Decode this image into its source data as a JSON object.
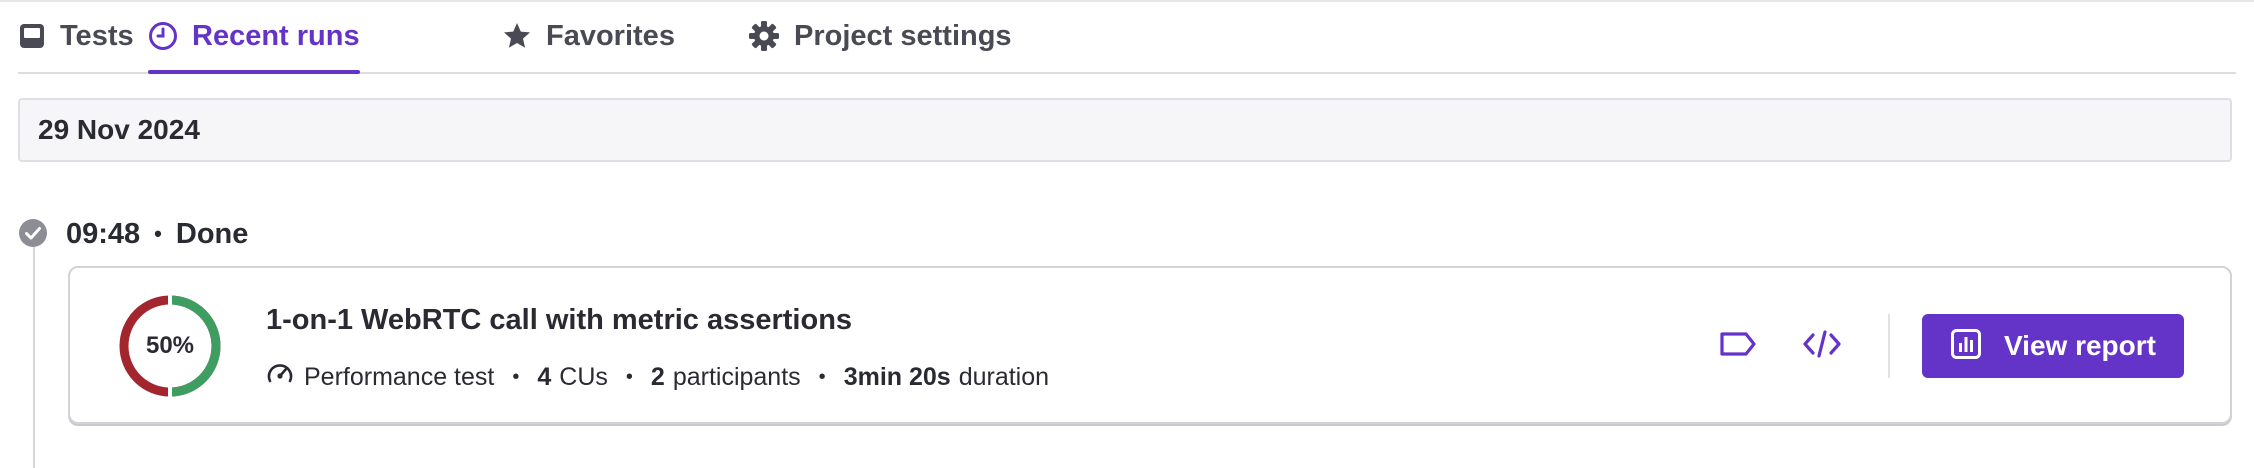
{
  "tabs": [
    {
      "label": "Tests",
      "icon": "inbox-icon",
      "active": false
    },
    {
      "label": "Recent runs",
      "icon": "clock-icon",
      "active": true
    },
    {
      "label": "Favorites",
      "icon": "star-icon",
      "active": false
    },
    {
      "label": "Project settings",
      "icon": "gear-icon",
      "active": false
    }
  ],
  "date_header": "29 Nov 2024",
  "run": {
    "time": "09:48",
    "separator": "•",
    "status": "Done",
    "status_icon": "check-circle-icon",
    "card": {
      "score_percent": 50,
      "score_label": "50%",
      "title": "1-on-1 WebRTC call with metric assertions",
      "test_type": "Performance test",
      "cus_value": "4",
      "cus_label": "CUs",
      "participants_value": "2",
      "participants_label": "participants",
      "duration_value": "3min 20s",
      "duration_label": "duration",
      "meta_separator": "•",
      "actions": {
        "tag_icon": "tag-icon",
        "code_icon": "code-icon",
        "view_report_label": "View report",
        "view_report_icon": "bar-chart-icon"
      }
    }
  },
  "colors": {
    "accent": "#6434c8",
    "pass": "#3e9e62",
    "fail": "#a3262e",
    "text": "#2a2a33",
    "muted": "#4a4a55"
  }
}
